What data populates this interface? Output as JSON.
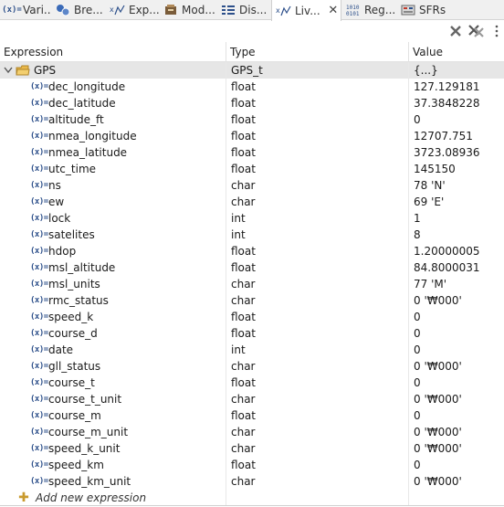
{
  "tabs": [
    {
      "label": "Vari...",
      "icon": "variables-icon"
    },
    {
      "label": "Bre...",
      "icon": "breakpoints-icon"
    },
    {
      "label": "Exp...",
      "icon": "expressions-icon"
    },
    {
      "label": "Mod...",
      "icon": "modules-icon"
    },
    {
      "label": "Dis...",
      "icon": "disassembly-icon"
    },
    {
      "label": "Liv...",
      "icon": "live-expressions-icon",
      "active": true
    },
    {
      "label": "Reg...",
      "icon": "registers-icon"
    },
    {
      "label": "SFRs",
      "icon": "sfrs-icon"
    }
  ],
  "toolbar": {
    "remove_icon": "remove-x-icon",
    "remove_all_icon": "remove-all-icon",
    "more_icon": "view-menu-icon"
  },
  "columns": {
    "expression": "Expression",
    "type": "Type",
    "value": "Value"
  },
  "root": {
    "name": "GPS",
    "type": "GPS_t",
    "value": "{...}"
  },
  "children": [
    {
      "name": "dec_longitude",
      "type": "float",
      "value": "127.129181"
    },
    {
      "name": "dec_latitude",
      "type": "float",
      "value": "37.3848228"
    },
    {
      "name": "altitude_ft",
      "type": "float",
      "value": "0"
    },
    {
      "name": "nmea_longitude",
      "type": "float",
      "value": "12707.751"
    },
    {
      "name": "nmea_latitude",
      "type": "float",
      "value": "3723.08936"
    },
    {
      "name": "utc_time",
      "type": "float",
      "value": "145150"
    },
    {
      "name": "ns",
      "type": "char",
      "value": "78 'N'"
    },
    {
      "name": "ew",
      "type": "char",
      "value": "69 'E'"
    },
    {
      "name": "lock",
      "type": "int",
      "value": "1"
    },
    {
      "name": "satelites",
      "type": "int",
      "value": "8"
    },
    {
      "name": "hdop",
      "type": "float",
      "value": "1.20000005"
    },
    {
      "name": "msl_altitude",
      "type": "float",
      "value": "84.8000031"
    },
    {
      "name": "msl_units",
      "type": "char",
      "value": "77 'M'"
    },
    {
      "name": "rmc_status",
      "type": "char",
      "value": "0 '₩000'"
    },
    {
      "name": "speed_k",
      "type": "float",
      "value": "0"
    },
    {
      "name": "course_d",
      "type": "float",
      "value": "0"
    },
    {
      "name": "date",
      "type": "int",
      "value": "0"
    },
    {
      "name": "gll_status",
      "type": "char",
      "value": "0 '₩000'"
    },
    {
      "name": "course_t",
      "type": "float",
      "value": "0"
    },
    {
      "name": "course_t_unit",
      "type": "char",
      "value": "0 '₩000'"
    },
    {
      "name": "course_m",
      "type": "float",
      "value": "0"
    },
    {
      "name": "course_m_unit",
      "type": "char",
      "value": "0 '₩000'"
    },
    {
      "name": "speed_k_unit",
      "type": "char",
      "value": "0 '₩000'"
    },
    {
      "name": "speed_km",
      "type": "float",
      "value": "0"
    },
    {
      "name": "speed_km_unit",
      "type": "char",
      "value": "0 '₩000'"
    }
  ],
  "var_icon_text": "(x)=",
  "add_expression": "Add new expression"
}
